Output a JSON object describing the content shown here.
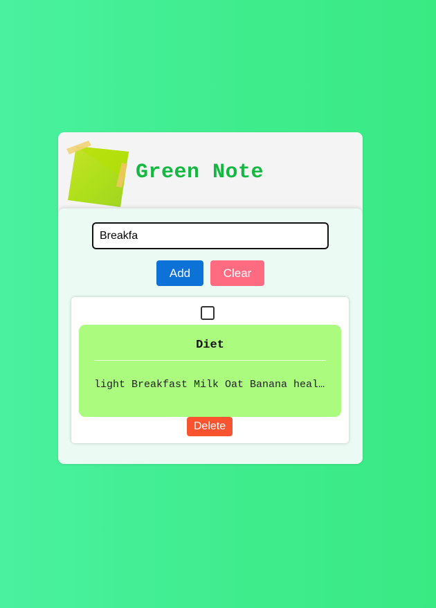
{
  "app": {
    "title": "Green Note"
  },
  "input": {
    "value": "Breakfa"
  },
  "buttons": {
    "add_label": "Add",
    "clear_label": "Clear"
  },
  "notes": [
    {
      "title": "Diet",
      "content": "light Breakfast Milk Oat Banana healthy",
      "checked": false,
      "delete_label": "Delete"
    }
  ],
  "colors": {
    "background_gradient": [
      "#4af19f",
      "#39ea83"
    ],
    "title": "#12b83f",
    "add_button": "#0d72d8",
    "clear_button": "#ff6b81",
    "delete_button": "#f9542f",
    "note_body": "#aafb7e"
  },
  "icons": {
    "logo": "sticky-note-logo-icon",
    "checkbox": "checkbox-icon"
  }
}
